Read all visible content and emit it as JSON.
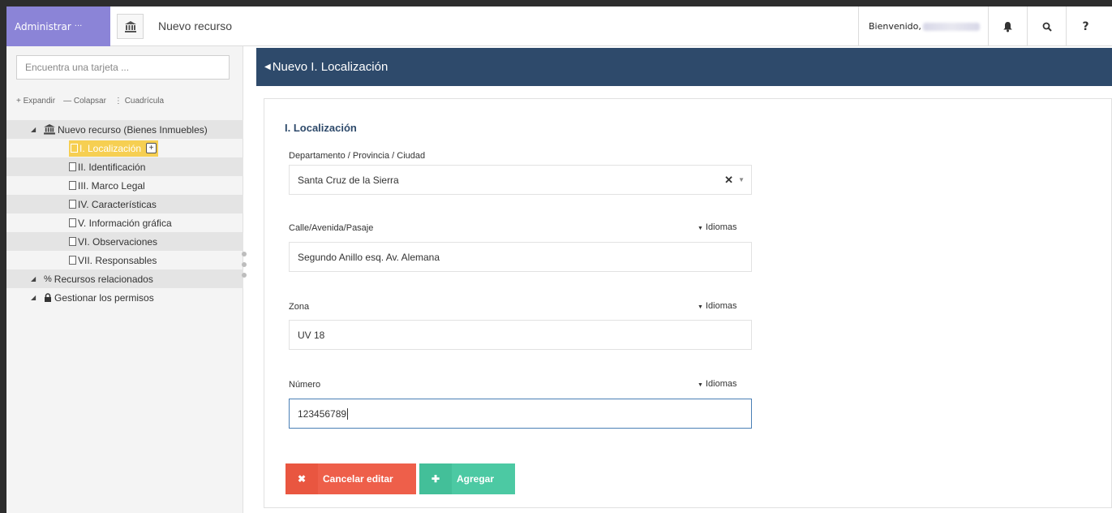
{
  "topbar": {
    "admin_label": "Administrar",
    "admin_dots": "···",
    "title": "Nuevo recurso",
    "welcome": "Bienvenido,",
    "icons": [
      "bell-icon",
      "search-icon",
      "help-icon"
    ],
    "help_glyph": "?"
  },
  "sidebar": {
    "search_placeholder": "Encuentra una tarjeta ...",
    "actions": {
      "expand": "Expandir",
      "collapse": "Colapsar",
      "grid": "Cuadrícula"
    },
    "tree": {
      "root": "Nuevo recurso (Bienes Inmuebles)",
      "cards": [
        "I. Localización",
        "II. Identificación",
        "III. Marco Legal",
        "IV. Características",
        "V. Información gráfica",
        "VI. Observaciones",
        "VII. Responsables"
      ],
      "related": "Recursos relacionados",
      "permissions": "Gestionar los permisos"
    }
  },
  "main": {
    "header": "Nuevo I. Localización",
    "section_title": "I. Localización",
    "languages_label": "Idiomas",
    "fields": {
      "department": {
        "label": "Departamento / Provincia / Ciudad",
        "value": "Santa Cruz de la Sierra"
      },
      "street": {
        "label": "Calle/Avenida/Pasaje",
        "value": "Segundo Anillo esq. Av. Alemana"
      },
      "zone": {
        "label": "Zona",
        "value": "UV 18"
      },
      "number": {
        "label": "Número",
        "value": "123456789"
      }
    },
    "buttons": {
      "cancel": "Cancelar editar",
      "add": "Agregar"
    }
  },
  "colors": {
    "admin_bg": "#8b84d7",
    "header_bg": "#2e4a6b",
    "selected_bg": "#f6cf52",
    "cancel_bg": "#ee5f4a",
    "add_bg": "#4cc9a3"
  }
}
